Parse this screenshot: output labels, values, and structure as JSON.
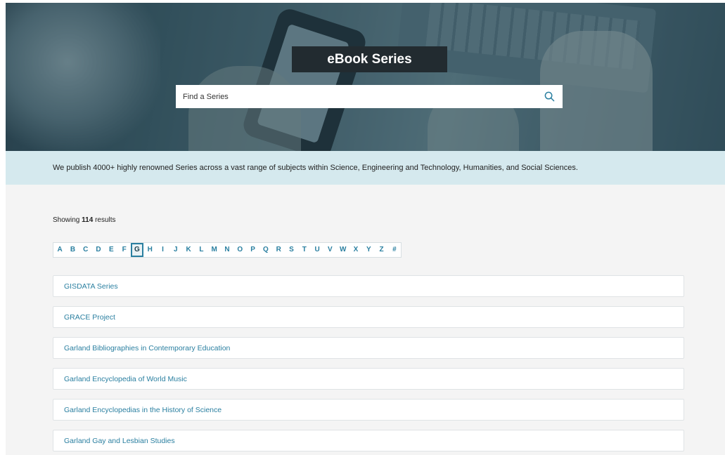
{
  "hero": {
    "title": "eBook Series",
    "search_placeholder": "Find a Series"
  },
  "intro": {
    "text": "We publish 4000+ highly renowned Series across a vast range of subjects within Science, Engineering and Technology, Humanities, and Social Sciences."
  },
  "results": {
    "prefix": "Showing",
    "count": "114",
    "suffix": "results"
  },
  "alphabet": {
    "letters": [
      "A",
      "B",
      "C",
      "D",
      "E",
      "F",
      "G",
      "H",
      "I",
      "J",
      "K",
      "L",
      "M",
      "N",
      "O",
      "P",
      "Q",
      "R",
      "S",
      "T",
      "U",
      "V",
      "W",
      "X",
      "Y",
      "Z",
      "#"
    ],
    "selected": "G"
  },
  "series": [
    "GISDATA Series",
    "GRACE Project",
    "Garland Bibliographies in Contemporary Education",
    "Garland Encyclopedia of World Music",
    "Garland Encyclopedias in the History of Science",
    "Garland Gay and Lesbian Studies"
  ],
  "colors": {
    "accent": "#2a7fa0",
    "intro_band": "#d5e9ee",
    "title_bg": "#222b30"
  }
}
